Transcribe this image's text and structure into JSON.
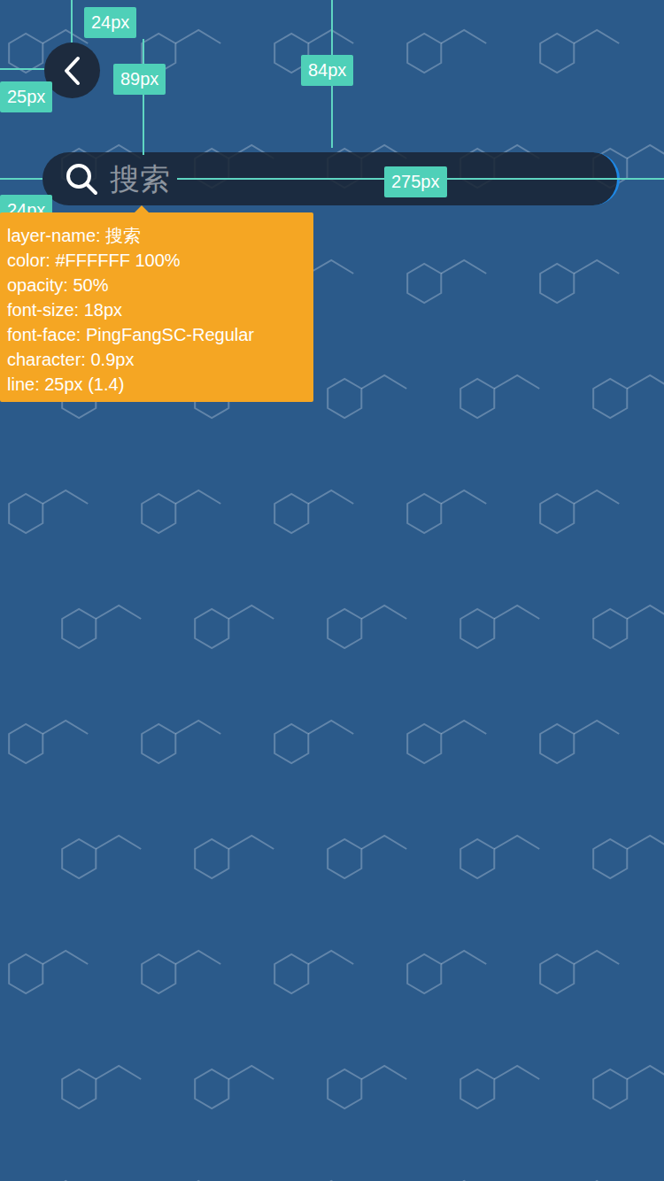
{
  "search": {
    "placeholder": "搜索"
  },
  "measurements": [
    {
      "label": "24px"
    },
    {
      "label": "89px"
    },
    {
      "label": "84px"
    },
    {
      "label": "25px"
    },
    {
      "label": "24px"
    },
    {
      "label": "275px"
    }
  ],
  "spec": {
    "lines": [
      "layer-name: 搜索",
      "color: #FFFFFF 100%",
      "opacity: 50%",
      "font-size: 18px",
      "font-face: PingFangSC-Regular",
      "character: 0.9px",
      "line: 25px (1.4)"
    ]
  }
}
